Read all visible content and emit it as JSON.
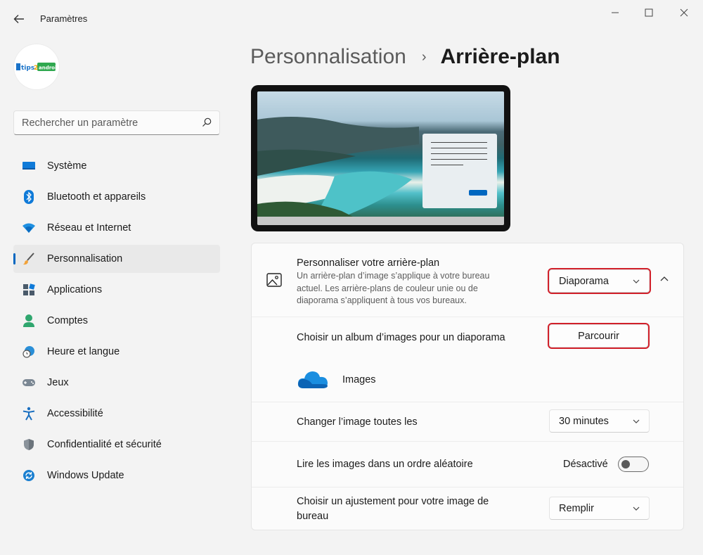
{
  "app": {
    "title": "Paramètres"
  },
  "avatar": {
    "logo_text": "tips2android"
  },
  "search": {
    "placeholder": "Rechercher un paramètre"
  },
  "sidebar": {
    "items": [
      {
        "label": "Système",
        "icon": "system-icon"
      },
      {
        "label": "Bluetooth et appareils",
        "icon": "bluetooth-icon"
      },
      {
        "label": "Réseau et Internet",
        "icon": "wifi-icon"
      },
      {
        "label": "Personnalisation",
        "icon": "brush-icon",
        "active": true
      },
      {
        "label": "Applications",
        "icon": "apps-icon"
      },
      {
        "label": "Comptes",
        "icon": "account-icon"
      },
      {
        "label": "Heure et langue",
        "icon": "clock-globe-icon"
      },
      {
        "label": "Jeux",
        "icon": "gamepad-icon"
      },
      {
        "label": "Accessibilité",
        "icon": "accessibility-icon"
      },
      {
        "label": "Confidentialité et sécurité",
        "icon": "shield-icon"
      },
      {
        "label": "Windows Update",
        "icon": "update-icon"
      }
    ]
  },
  "breadcrumb": {
    "parent": "Personnalisation",
    "separator": "›",
    "current": "Arrière-plan"
  },
  "background": {
    "title": "Personnaliser votre arrière-plan",
    "description_lines": [
      "Un arrière-plan d’image s’applique à votre bureau",
      "actuel. Les arrière-plans de couleur unie ou de",
      "diaporama s’appliquent à tous vos bureaux."
    ],
    "type_value": "Diaporama",
    "album_label": "Choisir un album d’images pour un diaporama",
    "browse_label": "Parcourir",
    "album_name": "Images",
    "interval_label": "Changer l’image toutes les",
    "interval_value": "30 minutes",
    "shuffle_label": "Lire les images dans un ordre aléatoire",
    "shuffle_state": "Désactivé",
    "fit_label_lines": [
      "Choisir un ajustement pour votre image de",
      "bureau"
    ],
    "fit_value": "Remplir"
  },
  "colors": {
    "accent": "#0067c0",
    "highlight": "#d1202a"
  }
}
